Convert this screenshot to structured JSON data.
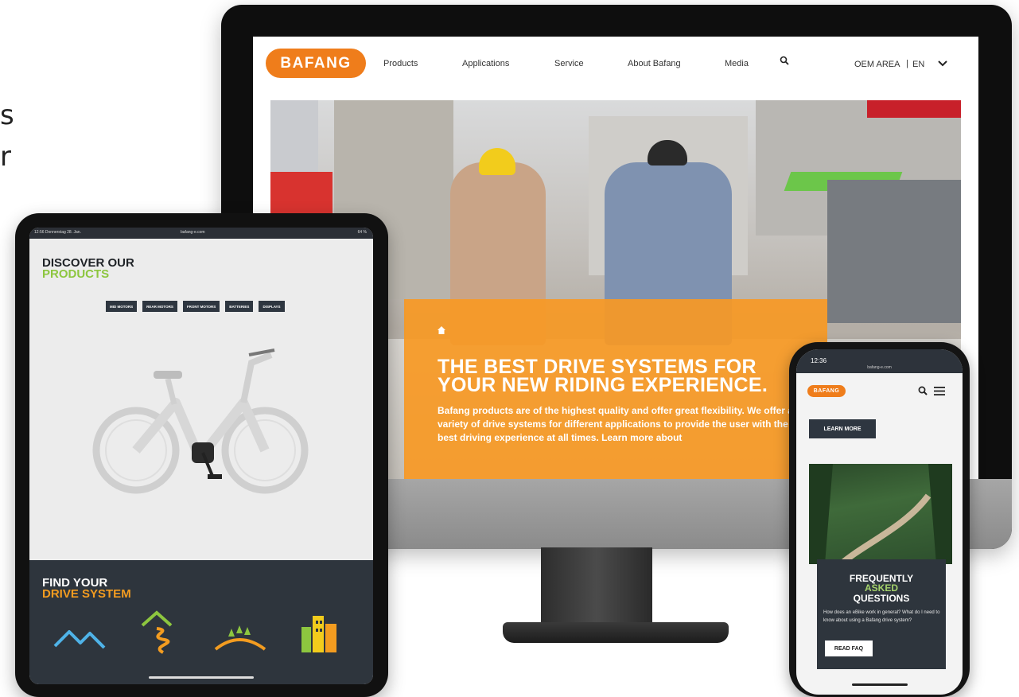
{
  "edge": {
    "line1": "s",
    "line2": "r"
  },
  "desktop": {
    "logo": "BAFANG",
    "nav": [
      "Products",
      "Applications",
      "Service",
      "About Bafang",
      "Media"
    ],
    "oem": "OEM AREA",
    "sep": "|",
    "lang": "EN",
    "hero": {
      "title_line1": "THE BEST DRIVE SYSTEMS FOR",
      "title_line2": "YOUR NEW RIDING EXPERIENCE.",
      "text": "Bafang products are of the highest quality and offer great flexibility. We offer a variety of drive systems for different applications to provide the user with the best driving experience at all times. Learn more about"
    }
  },
  "tablet": {
    "status_left": "12:56  Donnerstag 28. Jan.",
    "status_url": "bafang-e.com",
    "status_right": "64 %",
    "heading_line1": "DISCOVER OUR",
    "heading_line2": "PRODUCTS",
    "buttons": [
      "MID MOTORS",
      "REAR MOTORS",
      "FRONT MOTORS",
      "BATTERIES",
      "DISPLAYS"
    ],
    "find_line1": "FIND YOUR",
    "find_line2": "DRIVE SYSTEM"
  },
  "phone": {
    "time": "12:36",
    "url": "bafang-e.com",
    "logo": "BAFANG",
    "learn_more": "LEARN MORE",
    "faq_line1": "FREQUENTLY",
    "faq_line2": "ASKED",
    "faq_line3": "QUESTIONS",
    "faq_text": "How does an eBike work in general? What do I need to know about using a Bafang drive system?",
    "read_faq": "READ FAQ"
  },
  "colors": {
    "brand": "#ef7d1b",
    "hero_card": "#f79924",
    "green": "#8dc63f",
    "dark": "#2e353d"
  }
}
